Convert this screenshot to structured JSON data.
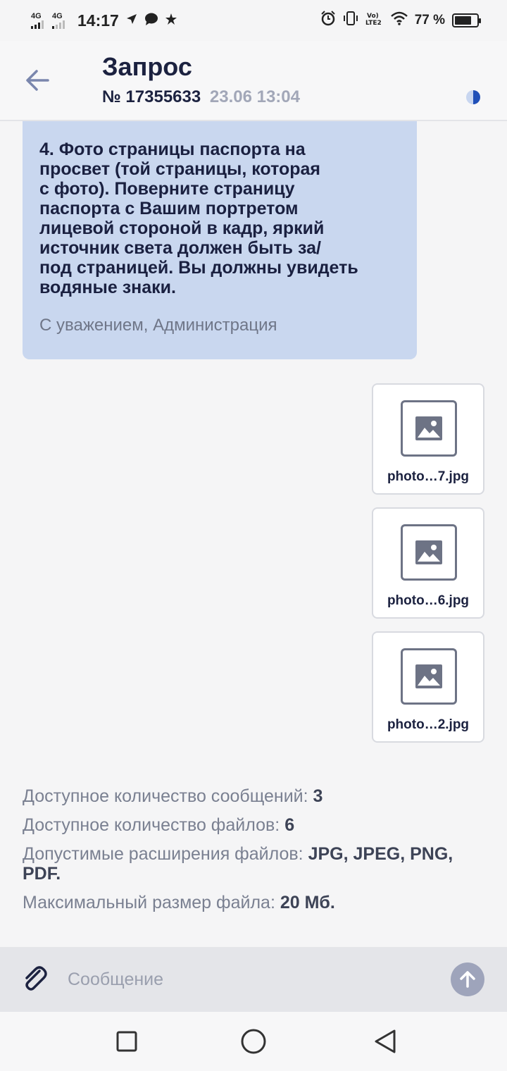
{
  "status_bar": {
    "net1": "4G",
    "net2": "4G",
    "time": "14:17",
    "battery_percent": "77 %",
    "battery_level": 0.77,
    "icons": [
      "navigation-icon",
      "message-icon",
      "star-icon",
      "alarm-icon",
      "vibrate-icon",
      "volte-icon",
      "wifi-icon",
      "battery-icon"
    ]
  },
  "header": {
    "title": "Запрос",
    "number": "№ 17355633",
    "date": "23.06 13:04",
    "status_color": "#1f4fb8"
  },
  "message": {
    "text": "4. Фото страницы паспорта на\nпросвет (той страницы, которая\nс фото). Поверните страницу\nпаспорта с Вашим портретом\nлицевой стороной в кадр, яркий\nисточник света должен быть за/\nпод страницей.  Вы должны увидеть\nводяные знаки.",
    "signature": "С уважением, Администрация",
    "bubble_color": "#c9d7ef"
  },
  "attachments": [
    {
      "name": "photo…7.jpg"
    },
    {
      "name": "photo…6.jpg"
    },
    {
      "name": "photo…2.jpg"
    }
  ],
  "limits": {
    "messages_label": "Доступное количество сообщений:",
    "messages_value": "3",
    "files_label": "Доступное количество файлов:",
    "files_value": "6",
    "ext_label": "Допустимые расширения файлов:",
    "ext_value": "JPG, JPEG, PNG, PDF.",
    "size_label": "Максимальный размер файла:",
    "size_value": "20 Мб."
  },
  "composer": {
    "placeholder": "Сообщение",
    "send_color": "#9ea4bb"
  },
  "navbar": {
    "icons": [
      "recents-icon",
      "home-icon",
      "back-nav-icon"
    ]
  }
}
